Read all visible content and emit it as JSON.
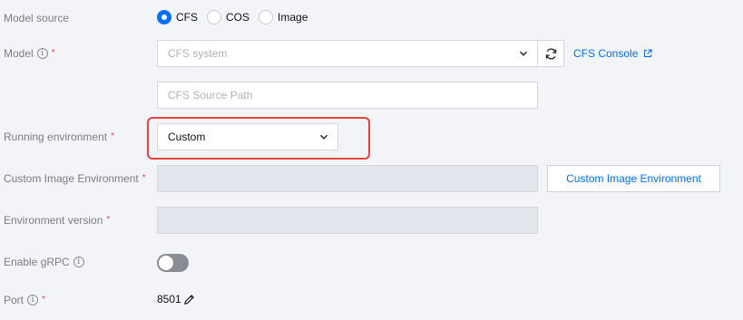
{
  "model_source": {
    "label": "Model source",
    "options": [
      {
        "label": "CFS",
        "checked": true
      },
      {
        "label": "COS",
        "checked": false
      },
      {
        "label": "Image",
        "checked": false
      }
    ]
  },
  "model": {
    "label": "Model",
    "select_placeholder": "CFS system",
    "console_link": "CFS Console",
    "source_path_placeholder": "CFS Source Path"
  },
  "running_environment": {
    "label": "Running environment",
    "value": "Custom"
  },
  "custom_image_environment": {
    "label": "Custom Image Environment",
    "button_label": "Custom Image Environment"
  },
  "environment_version": {
    "label": "Environment version"
  },
  "enable_grpc": {
    "label": "Enable gRPC",
    "enabled": false
  },
  "port": {
    "label": "Port",
    "value": "8501"
  },
  "required_mark": "*",
  "info_glyph": "i",
  "colors": {
    "accent": "#006eff",
    "required": "#e54545",
    "highlight": "#e9433d"
  }
}
